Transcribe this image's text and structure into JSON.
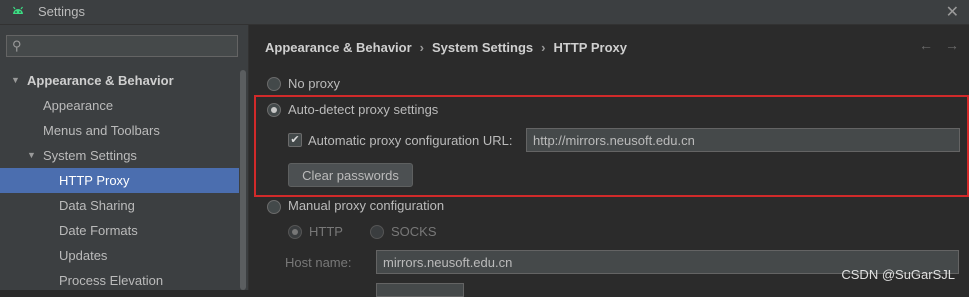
{
  "window": {
    "title": "Settings",
    "close_icon": "close-icon"
  },
  "sidebar": {
    "search_placeholder": "",
    "items": [
      {
        "label": "Appearance & Behavior",
        "expanded": true,
        "level": 0
      },
      {
        "label": "Appearance",
        "level": 1
      },
      {
        "label": "Menus and Toolbars",
        "level": 1
      },
      {
        "label": "System Settings",
        "expanded": true,
        "level": 1
      },
      {
        "label": "HTTP Proxy",
        "level": 2,
        "selected": true
      },
      {
        "label": "Data Sharing",
        "level": 2
      },
      {
        "label": "Date Formats",
        "level": 2
      },
      {
        "label": "Updates",
        "level": 2
      },
      {
        "label": "Process Elevation",
        "level": 2
      }
    ]
  },
  "breadcrumb": [
    "Appearance & Behavior",
    "System Settings",
    "HTTP Proxy"
  ],
  "proxy": {
    "no_proxy": "No proxy",
    "auto_detect": "Auto-detect proxy settings",
    "auto_config_label": "Automatic proxy configuration URL:",
    "auto_config_url": "http://mirrors.neusoft.edu.cn",
    "auto_config_checked": true,
    "clear_passwords": "Clear passwords",
    "manual": "Manual proxy configuration",
    "http": "HTTP",
    "socks": "SOCKS",
    "host_label": "Host name:",
    "host_value": "mirrors.neusoft.edu.cn",
    "selected_mode": "auto_detect"
  },
  "watermark": "CSDN @SuGarSJL",
  "colors": {
    "selection": "#4b6eaf",
    "highlight_box": "#d12a2a",
    "background": "#2b2b2b"
  }
}
